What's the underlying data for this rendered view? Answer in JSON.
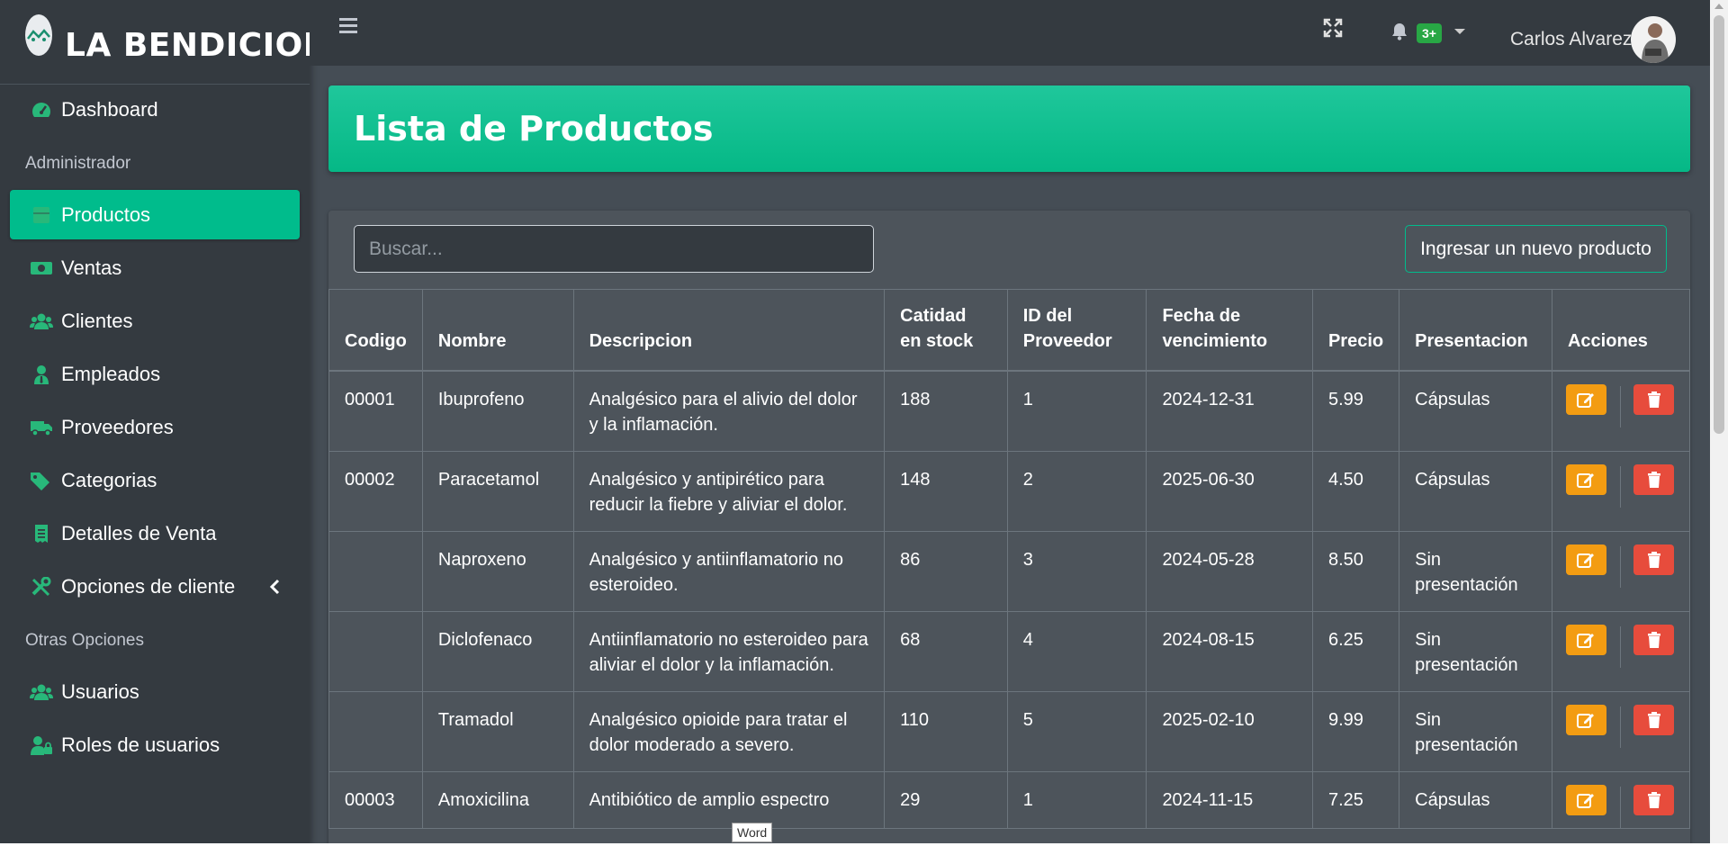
{
  "brand": {
    "name": "LA BENDICION",
    "logo_icon": "store-logo-icon"
  },
  "sidebar": {
    "items": [
      {
        "type": "item",
        "label": "Dashboard",
        "icon": "tachometer-icon"
      },
      {
        "type": "header",
        "label": "Administrador"
      },
      {
        "type": "item",
        "label": "Productos",
        "icon": "box-icon",
        "active": true
      },
      {
        "type": "item",
        "label": "Ventas",
        "icon": "money-icon"
      },
      {
        "type": "item",
        "label": "Clientes",
        "icon": "users-icon"
      },
      {
        "type": "item",
        "label": "Empleados",
        "icon": "user-tie-icon"
      },
      {
        "type": "item",
        "label": "Proveedores",
        "icon": "truck-icon"
      },
      {
        "type": "item",
        "label": "Categorias",
        "icon": "tags-icon"
      },
      {
        "type": "item",
        "label": "Detalles de Venta",
        "icon": "receipt-icon"
      },
      {
        "type": "item",
        "label": "Opciones de cliente",
        "icon": "tools-icon",
        "expandable": true
      },
      {
        "type": "header",
        "label": "Otras Opciones"
      },
      {
        "type": "item",
        "label": "Usuarios",
        "icon": "users-icon"
      },
      {
        "type": "item",
        "label": "Roles de usuarios",
        "icon": "user-lock-icon"
      }
    ]
  },
  "topbar": {
    "notifications_badge": "3+",
    "user_name": "Carlos Alvarez"
  },
  "page": {
    "title": "Lista de Productos"
  },
  "toolbar": {
    "search_placeholder": "Buscar...",
    "new_button_label": "Ingresar un nuevo producto"
  },
  "table": {
    "columns": [
      "Codigo",
      "Nombre",
      "Descripcion",
      "Catidad en stock",
      "ID del Proveedor",
      "Fecha de vencimiento",
      "Precio",
      "Presentacion",
      "Acciones"
    ],
    "rows": [
      [
        "00001",
        "Ibuprofeno",
        "Analgésico para el alivio del dolor y la inflamación.",
        "188",
        "1",
        "2024-12-31",
        "5.99",
        "Cápsulas"
      ],
      [
        "00002",
        "Paracetamol",
        "Analgésico y antipirético para reducir la fiebre y aliviar el dolor.",
        "148",
        "2",
        "2025-06-30",
        "4.50",
        "Cápsulas"
      ],
      [
        "",
        "Naproxeno",
        "Analgésico y antiinflamatorio no esteroideo.",
        "86",
        "3",
        "2024-05-28",
        "8.50",
        "Sin presentación"
      ],
      [
        "",
        "Diclofenaco",
        "Antiinflamatorio no esteroideo para aliviar el dolor y la inflamación.",
        "68",
        "4",
        "2024-08-15",
        "6.25",
        "Sin presentación"
      ],
      [
        "",
        "Tramadol",
        "Analgésico opioide para tratar el dolor moderado a severo.",
        "110",
        "5",
        "2025-02-10",
        "9.99",
        "Sin presentación"
      ],
      [
        "00003",
        "Amoxicilina",
        "Antibiótico de amplio espectro",
        "29",
        "1",
        "2024-11-15",
        "7.25",
        "Cápsulas"
      ]
    ]
  },
  "tooltip": {
    "text": "Word"
  },
  "colors": {
    "accent": "#00bc8c",
    "edit": "#f39c12",
    "delete": "#e74c3c",
    "badge": "#28a745"
  }
}
